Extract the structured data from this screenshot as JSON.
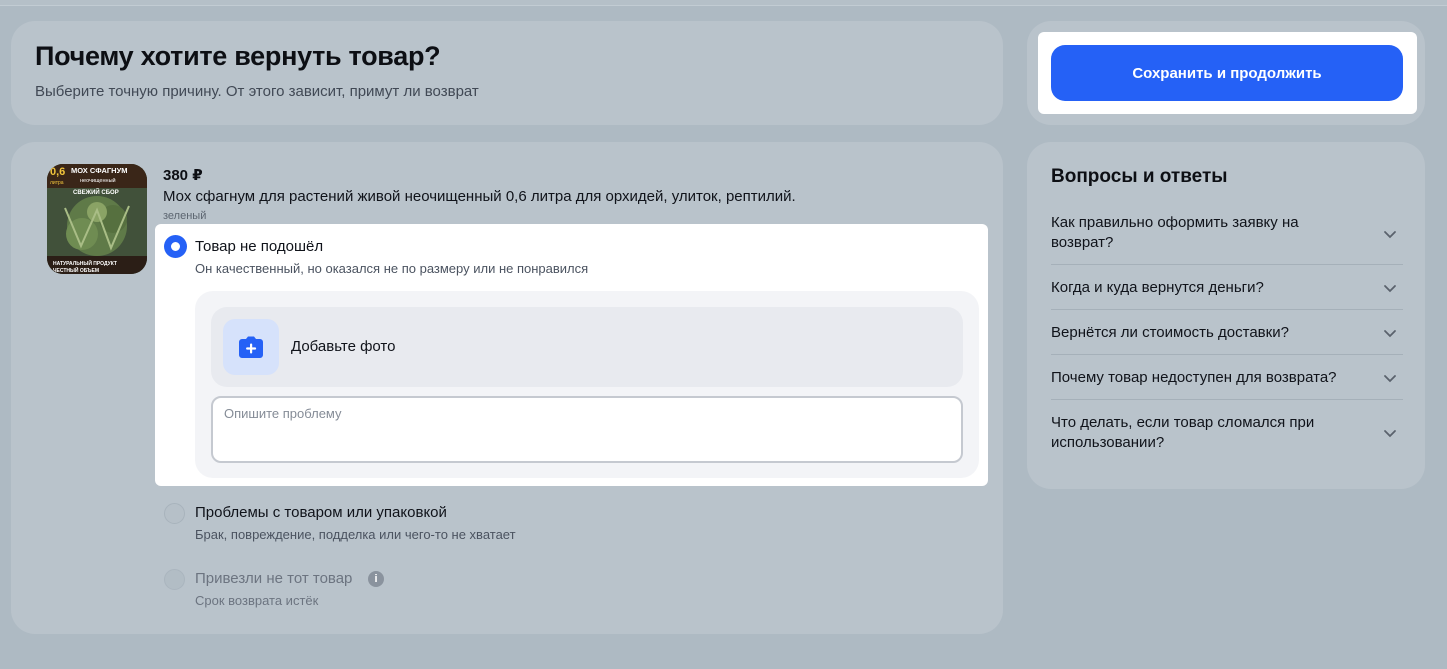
{
  "header": {
    "title": "Почему хотите вернуть товар?",
    "subtitle": "Выберите точную причину. От этого зависит, примут ли возврат"
  },
  "actions": {
    "save_label": "Сохранить и продолжить"
  },
  "product": {
    "price": "380 ₽",
    "name": "Мох сфагнум для растений живой неочищенный 0,6 литра для орхидей, улиток, рептилий.",
    "variant": "зеленый",
    "thumb_text": {
      "volume": "0,6",
      "volume_unit": "литра",
      "brand": "МОХ СФАГНУМ",
      "type": "неочищенный",
      "tagline": "СВЕЖИЙ СБОР",
      "badge_1": "НАТУРАЛЬНЫЙ ПРОДУКТ",
      "badge_2": "ЧЕСТНЫЙ ОБЪЕМ"
    }
  },
  "reasons": [
    {
      "title": "Товар не подошёл",
      "description": "Он качественный, но оказался не по размеру или не понравился",
      "state": "selected"
    },
    {
      "title": "Проблемы с товаром или упаковкой",
      "description": "Брак, повреждение, подделка или чего-то не хватает",
      "state": "unselected"
    },
    {
      "title": "Привезли не тот товар",
      "description": "Срок возврата истёк",
      "state": "disabled"
    }
  ],
  "upload": {
    "add_photo_label": "Добавьте фото",
    "describe_placeholder": "Опишите проблему"
  },
  "faq": {
    "title": "Вопросы и ответы",
    "items": [
      {
        "question": "Как правильно оформить заявку на возврат?"
      },
      {
        "question": "Когда и куда вернутся деньги?"
      },
      {
        "question": "Вернётся ли стоимость доставки?"
      },
      {
        "question": "Почему товар недоступен для возврата?"
      },
      {
        "question": "Что делать, если товар сломался при использовании?"
      }
    ]
  },
  "colors": {
    "accent": "#2561f6",
    "background": "#aebac3",
    "card": "#b9c3cb"
  }
}
